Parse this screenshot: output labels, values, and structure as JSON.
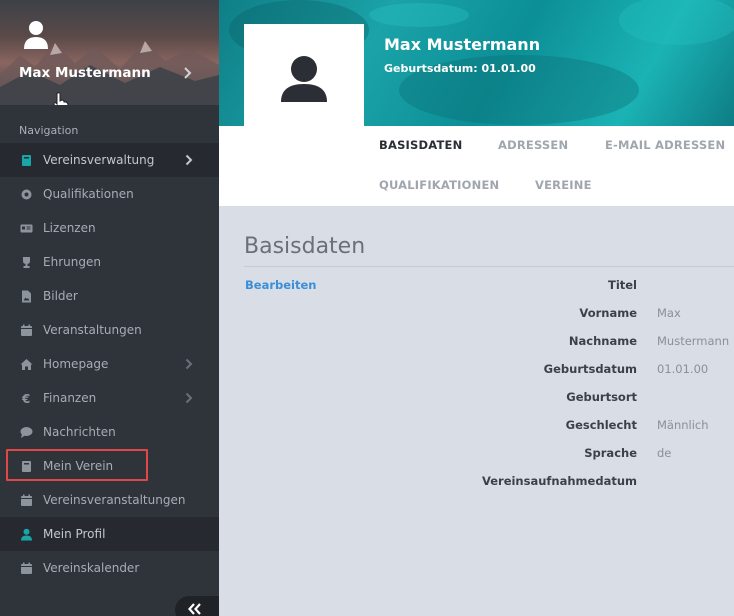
{
  "user": {
    "name": "Max Mustermann"
  },
  "nav": {
    "title": "Navigation",
    "items": [
      {
        "label": "Vereinsverwaltung",
        "icon": "book-icon",
        "chevron": true,
        "active": true
      },
      {
        "label": "Qualifikationen",
        "icon": "gear-badge-icon",
        "chevron": false
      },
      {
        "label": "Lizenzen",
        "icon": "id-card-icon",
        "chevron": false
      },
      {
        "label": "Ehrungen",
        "icon": "trophy-icon",
        "chevron": false
      },
      {
        "label": "Bilder",
        "icon": "image-file-icon",
        "chevron": false
      },
      {
        "label": "Veranstaltungen",
        "icon": "calendar-icon",
        "chevron": false
      },
      {
        "label": "Homepage",
        "icon": "home-icon",
        "chevron": true
      },
      {
        "label": "Finanzen",
        "icon": "euro-icon",
        "chevron": true
      },
      {
        "label": "Nachrichten",
        "icon": "chat-icon",
        "chevron": false
      },
      {
        "label": "Mein Verein",
        "icon": "book-icon",
        "chevron": false
      },
      {
        "label": "Vereinsveranstaltungen",
        "icon": "calendar-icon",
        "chevron": false
      },
      {
        "label": "Mein Profil",
        "icon": "user-icon",
        "chevron": false,
        "selected": true
      },
      {
        "label": "Vereinskalender",
        "icon": "calendar-icon",
        "chevron": false
      }
    ]
  },
  "profile": {
    "name": "Max Mustermann",
    "dob_label": "Geburtsdatum: 01.01.00"
  },
  "tabs": [
    {
      "label": "BASISDATEN",
      "active": true
    },
    {
      "label": "ADRESSEN"
    },
    {
      "label": "E-MAIL ADRESSEN"
    },
    {
      "label": "QUALIFIKATIONEN"
    },
    {
      "label": "VEREINE"
    }
  ],
  "basisdaten": {
    "title": "Basisdaten",
    "edit": "Bearbeiten",
    "fields": [
      {
        "label": "Titel",
        "value": ""
      },
      {
        "label": "Vorname",
        "value": "Max"
      },
      {
        "label": "Nachname",
        "value": "Mustermann"
      },
      {
        "label": "Geburtsdatum",
        "value": "01.01.00"
      },
      {
        "label": "Geburtsort",
        "value": ""
      },
      {
        "label": "Geschlecht",
        "value": "Männlich"
      },
      {
        "label": "Sprache",
        "value": "de"
      },
      {
        "label": "Vereinsaufnahmedatum",
        "value": ""
      }
    ]
  },
  "colors": {
    "accent": "#19a6a8",
    "link": "#3a8fd8",
    "highlight": "#e04848",
    "sidebar": "#2f343b"
  }
}
